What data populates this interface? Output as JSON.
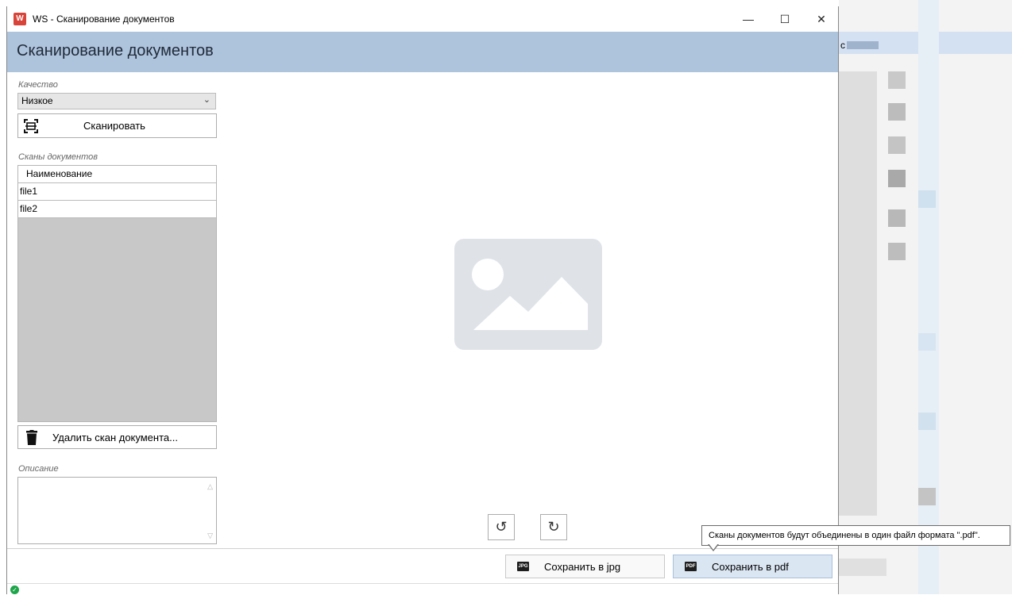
{
  "window": {
    "title": "WS - Сканирование документов",
    "minimize": "—",
    "maximize": "☐",
    "close": "✕"
  },
  "header": {
    "title": "Сканирование документов"
  },
  "quality": {
    "label": "Качество",
    "selected": "Низкое"
  },
  "scan_button": {
    "label": "Сканировать"
  },
  "scans": {
    "label": "Сканы документов",
    "column_header": "Наименование",
    "rows": [
      "file1",
      "file2"
    ]
  },
  "delete_button": {
    "label": "Удалить скан документа..."
  },
  "description": {
    "label": "Описание",
    "value": ""
  },
  "rotate": {
    "left": "↺",
    "right": "↻"
  },
  "save_jpg": {
    "badge": "JPG",
    "label": "Сохранить в jpg"
  },
  "save_pdf": {
    "badge": "PDF",
    "label": "Сохранить в pdf"
  },
  "tooltip": {
    "text": "Сканы документов будут объединены в один файл формата \".pdf\"."
  },
  "background": {
    "partial_text": "c"
  },
  "colors": {
    "header_bg": "#aec3dc",
    "pdf_button_bg": "#dbe6f3",
    "list_bg": "#c8c8c8",
    "placeholder": "#dfe3e7",
    "status_ok": "#1ea54a"
  }
}
